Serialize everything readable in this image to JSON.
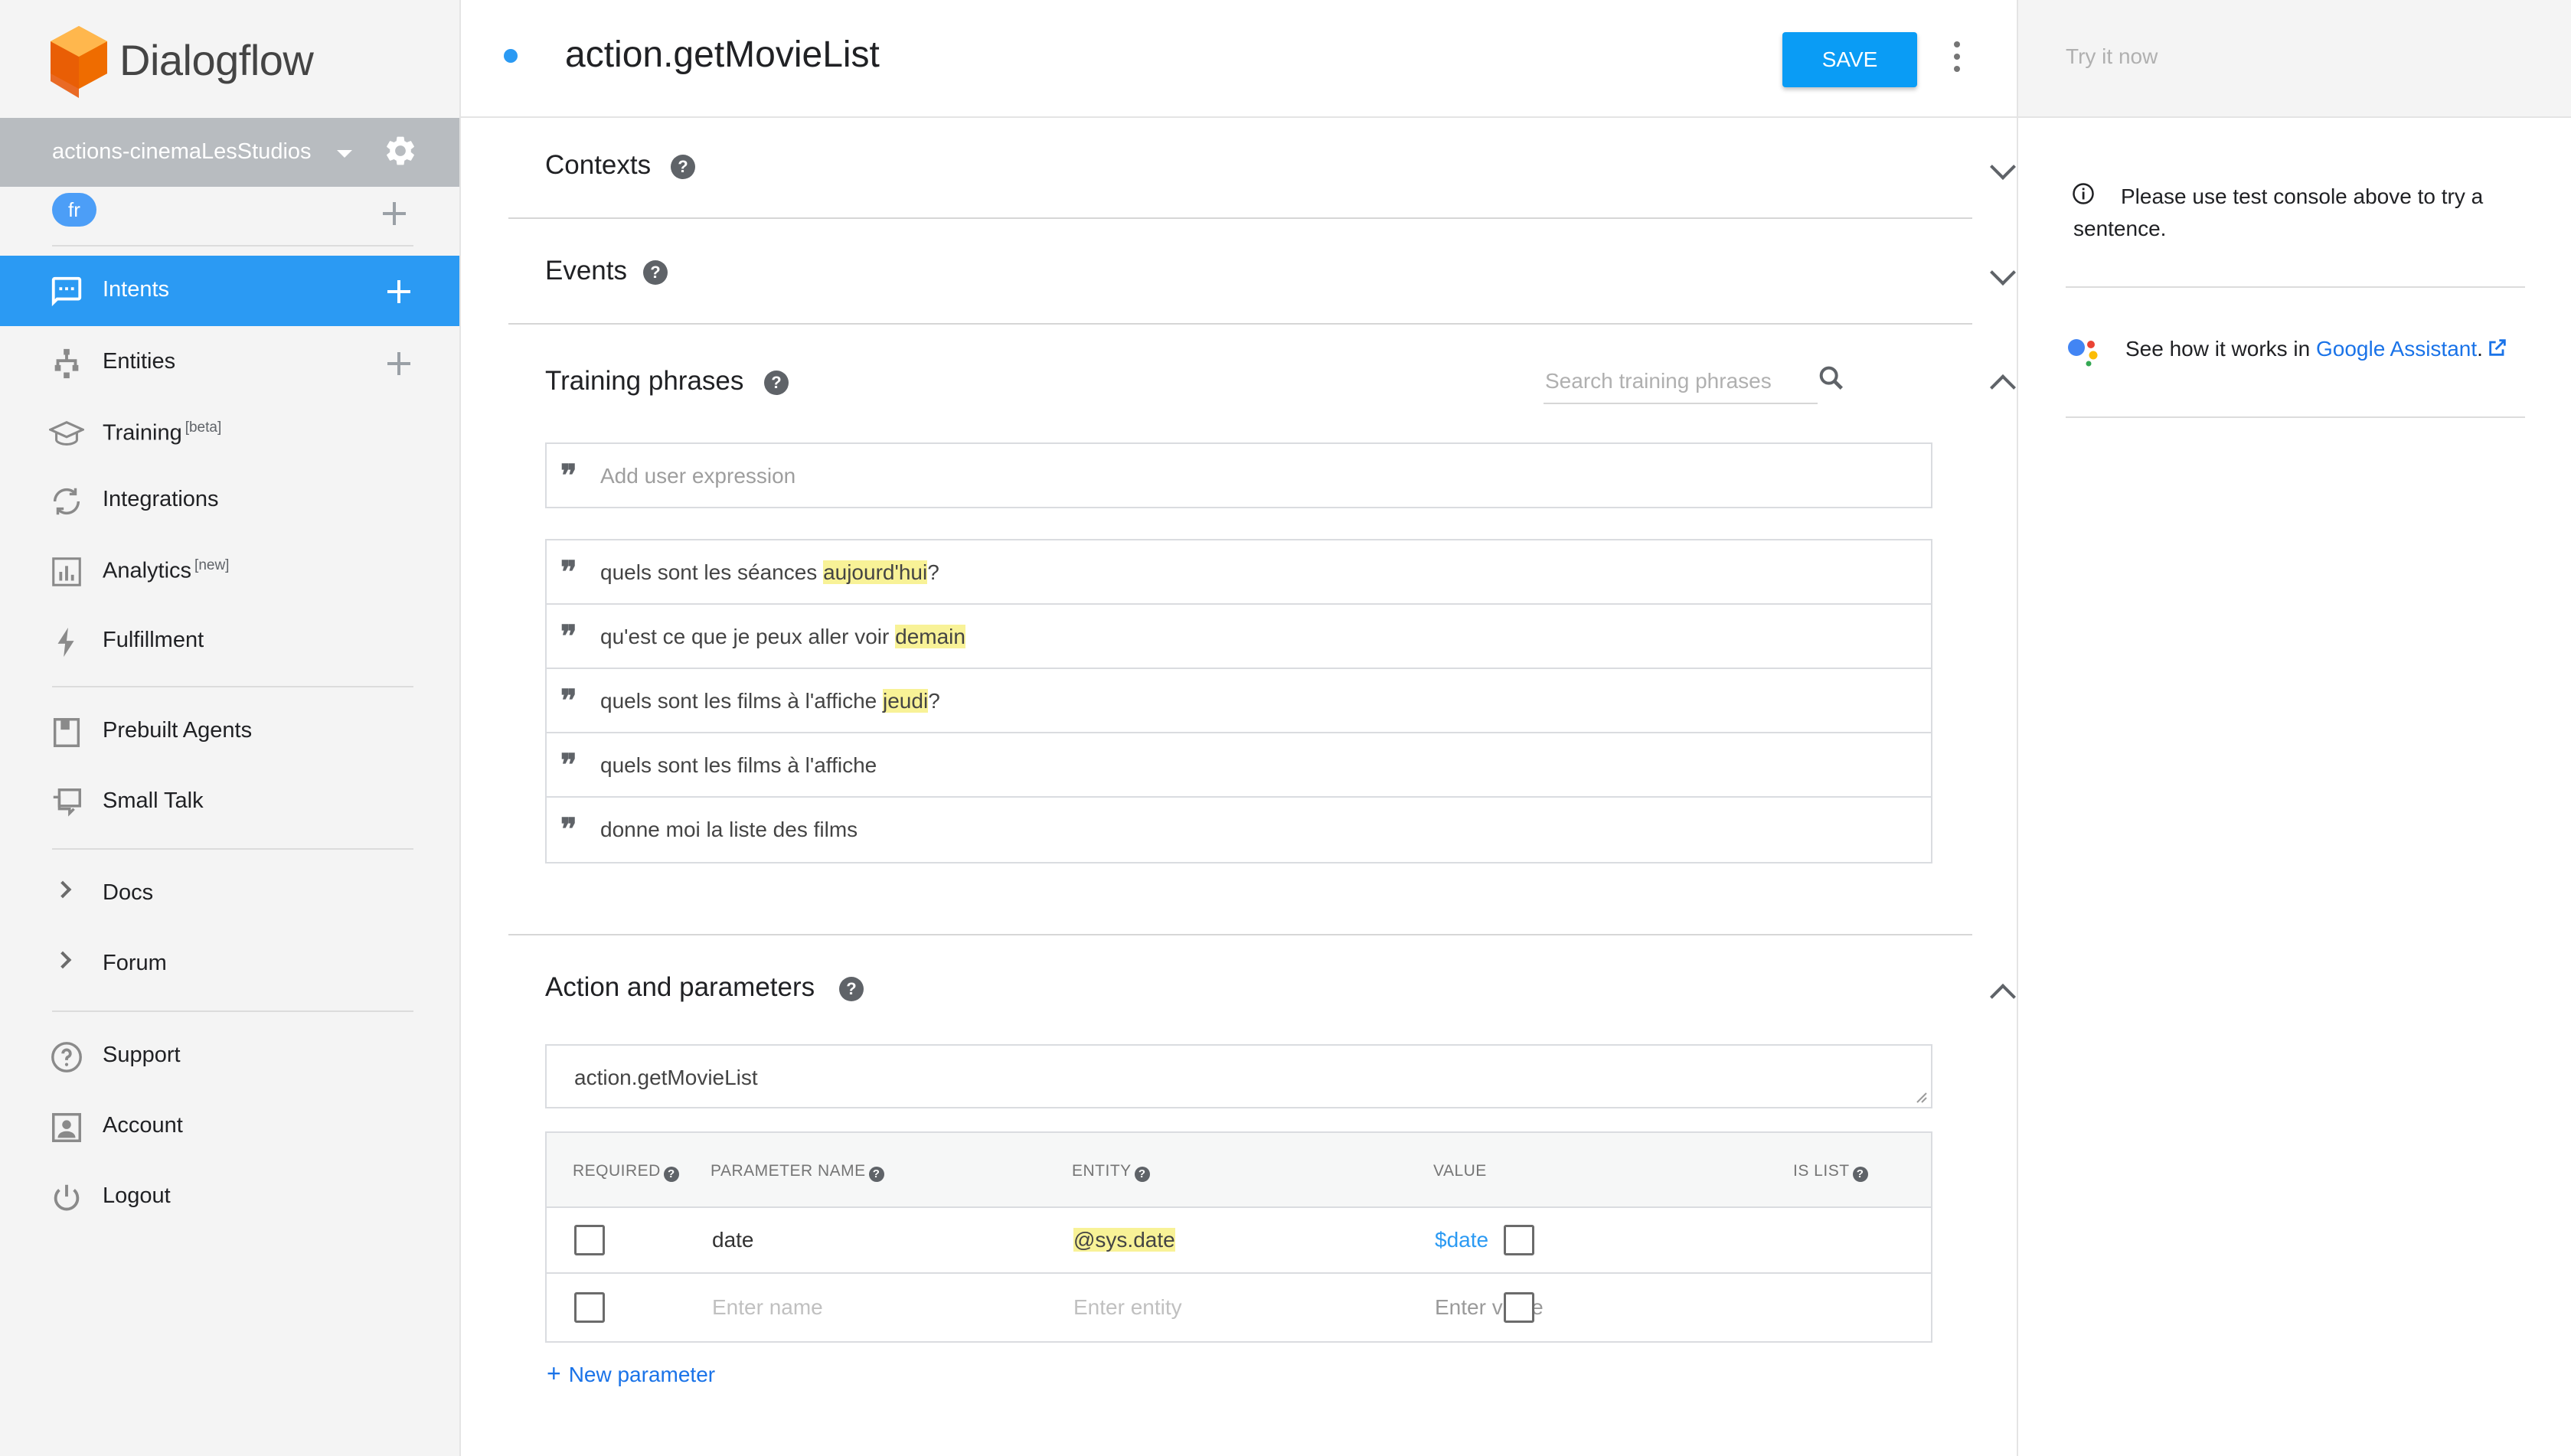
{
  "app": {
    "logo_text": "Dialogflow"
  },
  "agent": {
    "name": "actions-cinemaLesStudios",
    "language": "fr"
  },
  "nav": {
    "intents": "Intents",
    "entities": "Entities",
    "training": "Training",
    "training_badge": "[beta]",
    "integrations": "Integrations",
    "analytics": "Analytics",
    "analytics_badge": "[new]",
    "fulfillment": "Fulfillment",
    "prebuilt_agents": "Prebuilt Agents",
    "small_talk": "Small Talk",
    "docs": "Docs",
    "forum": "Forum",
    "support": "Support",
    "account": "Account",
    "logout": "Logout"
  },
  "header": {
    "intent_name": "action.getMovieList",
    "save_label": "SAVE"
  },
  "sections": {
    "contexts": "Contexts",
    "events": "Events",
    "training_phrases": "Training phrases",
    "action_params": "Action and parameters"
  },
  "training": {
    "search_placeholder": "Search training phrases",
    "add_placeholder": "Add user expression",
    "phrases": [
      {
        "before": "quels sont les séances ",
        "highlight": "aujourd'hui",
        "after": "?"
      },
      {
        "before": "qu'est ce que je peux aller voir ",
        "highlight": "demain",
        "after": ""
      },
      {
        "before": "quels sont les films à l'affiche ",
        "highlight": "jeudi",
        "after": "?"
      },
      {
        "before": "quels sont les films à l'affiche",
        "highlight": "",
        "after": ""
      },
      {
        "before": "donne moi la liste des films",
        "highlight": "",
        "after": ""
      }
    ]
  },
  "action": {
    "value": "action.getMovieList",
    "columns": {
      "required": "REQUIRED",
      "parameter_name": "PARAMETER NAME",
      "entity": "ENTITY",
      "value": "VALUE",
      "is_list": "IS LIST"
    },
    "params": [
      {
        "name": "date",
        "entity": "@sys.date",
        "value": "$date"
      }
    ],
    "placeholders": {
      "name": "Enter name",
      "entity": "Enter entity",
      "value": "Enter value"
    },
    "new_parameter": "New parameter"
  },
  "console": {
    "try_placeholder": "Try it now",
    "info": "Please use test console above to try a sentence.",
    "ga_prefix": "See how it works in ",
    "ga_link": "Google Assistant",
    "ga_suffix": "."
  },
  "colors": {
    "accent": "#2b9af3",
    "save": "#0a9cf5",
    "highlight": "#f8f297",
    "link": "#1a73e8"
  }
}
